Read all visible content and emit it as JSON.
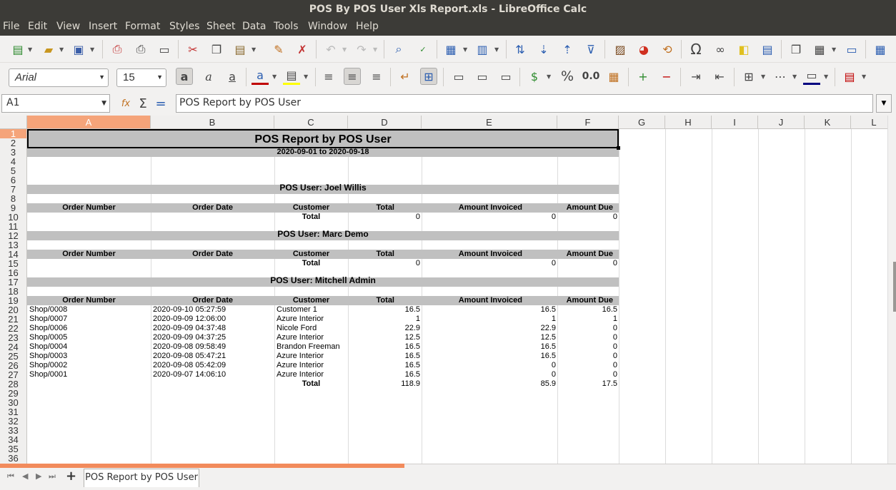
{
  "window": {
    "title": "POS By POS User Xls Report.xls - LibreOffice Calc"
  },
  "menu": [
    "File",
    "Edit",
    "View",
    "Insert",
    "Format",
    "Styles",
    "Sheet",
    "Data",
    "Tools",
    "Window",
    "Help"
  ],
  "toolbar": {
    "font_name": "Arial",
    "font_size": "15",
    "percent_label": "%",
    "decimal_label": "0.0"
  },
  "formula_bar": {
    "cell_ref": "A1",
    "content": "POS Report by POS User"
  },
  "columns": [
    "A",
    "B",
    "C",
    "D",
    "E",
    "F",
    "G",
    "H",
    "I",
    "J",
    "K",
    "L"
  ],
  "rows": [
    "1",
    "2",
    "3",
    "4",
    "5",
    "6",
    "7",
    "8",
    "9",
    "10",
    "11",
    "12",
    "13",
    "14",
    "15",
    "16",
    "17",
    "18",
    "19",
    "20",
    "21",
    "22",
    "23",
    "24",
    "25",
    "26",
    "27",
    "28",
    "29",
    "30",
    "31",
    "32",
    "33",
    "34",
    "35",
    "36"
  ],
  "report": {
    "title": "POS Report by POS User",
    "date_range": "2020-09-01 to 2020-09-18",
    "headers": [
      "Order Number",
      "Order Date",
      "Customer",
      "Total",
      "Amount Invoiced",
      "Amount Due"
    ],
    "total_label": "Total",
    "sections": [
      {
        "user": "POS User: Joel Willis",
        "orders": [],
        "totals": [
          "0",
          "0",
          "0"
        ]
      },
      {
        "user": "POS User: Marc Demo",
        "orders": [],
        "totals": [
          "0",
          "0",
          "0"
        ]
      },
      {
        "user": "POS User: Mitchell Admin",
        "orders": [
          [
            "Shop/0008",
            "2020-09-10 05:27:59",
            "Customer 1",
            "16.5",
            "16.5",
            "16.5"
          ],
          [
            "Shop/0007",
            "2020-09-09 12:06:00",
            "Azure Interior",
            "1",
            "1",
            "1"
          ],
          [
            "Shop/0006",
            "2020-09-09 04:37:48",
            "Nicole Ford",
            "22.9",
            "22.9",
            "0"
          ],
          [
            "Shop/0005",
            "2020-09-09 04:37:25",
            "Azure Interior",
            "12.5",
            "12.5",
            "0"
          ],
          [
            "Shop/0004",
            "2020-09-08 09:58:49",
            "Brandon Freeman",
            "16.5",
            "16.5",
            "0"
          ],
          [
            "Shop/0003",
            "2020-09-08 05:47:21",
            "Azure Interior",
            "16.5",
            "16.5",
            "0"
          ],
          [
            "Shop/0002",
            "2020-09-08 05:42:09",
            "Azure Interior",
            "16.5",
            "0",
            "0"
          ],
          [
            "Shop/0001",
            "2020-09-07 14:06:10",
            "Azure Interior",
            "16.5",
            "0",
            "0"
          ]
        ],
        "totals": [
          "118.9",
          "85.9",
          "17.5"
        ]
      }
    ]
  },
  "sheet_tabs": [
    {
      "label": "POS Report by POS User"
    }
  ],
  "colors": {
    "accent": "#f5a47a",
    "band": "#c0c0c0"
  }
}
